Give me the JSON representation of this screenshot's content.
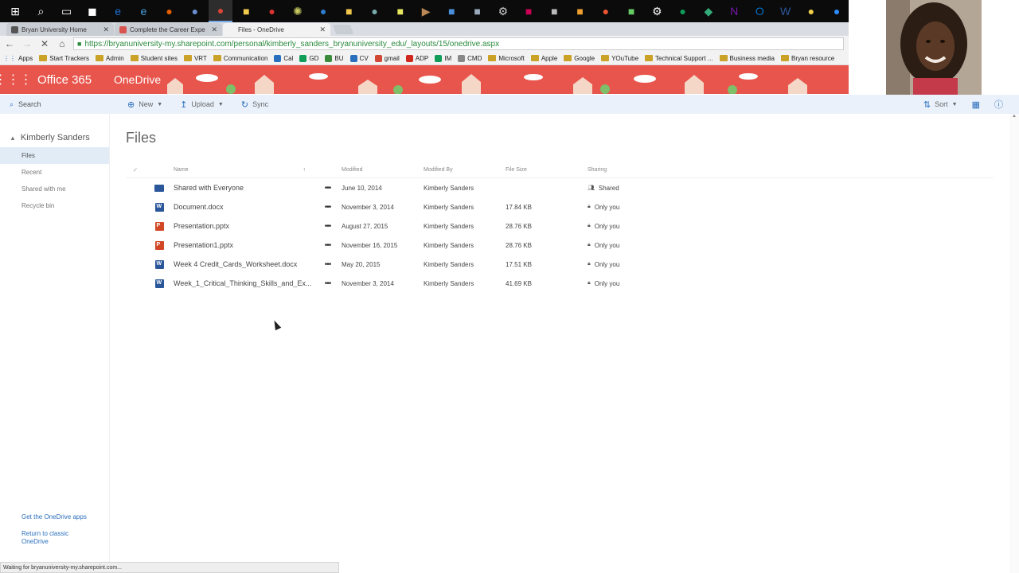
{
  "taskbar": {
    "icons": [
      {
        "name": "windows-start-icon",
        "color": "#ffffff",
        "glyph": "⊞"
      },
      {
        "name": "search-icon",
        "color": "#ffffff",
        "glyph": "⌕"
      },
      {
        "name": "task-view-icon",
        "color": "#ffffff",
        "glyph": "▭"
      },
      {
        "name": "store-icon",
        "color": "#ffffff",
        "glyph": "◼"
      },
      {
        "name": "edge-icon",
        "color": "#1e73d8",
        "glyph": "e"
      },
      {
        "name": "ie-icon",
        "color": "#4aa3df",
        "glyph": "e"
      },
      {
        "name": "firefox-icon",
        "color": "#e66000",
        "glyph": "●"
      },
      {
        "name": "globe-icon",
        "color": "#6a8fd0",
        "glyph": "●"
      },
      {
        "name": "chrome-icon",
        "color": "#db4437",
        "glyph": "●"
      },
      {
        "name": "file-explorer-icon",
        "color": "#f2c94c",
        "glyph": "■"
      },
      {
        "name": "media-icon",
        "color": "#d33",
        "glyph": "●"
      },
      {
        "name": "app-icon",
        "color": "#c8c860",
        "glyph": "✺"
      },
      {
        "name": "app-icon",
        "color": "#2d7dd2",
        "glyph": "●"
      },
      {
        "name": "folder-icon",
        "color": "#f2c94c",
        "glyph": "■"
      },
      {
        "name": "app-icon",
        "color": "#7aa",
        "glyph": "●"
      },
      {
        "name": "app-icon",
        "color": "#e8e860",
        "glyph": "■"
      },
      {
        "name": "app-icon",
        "color": "#b85",
        "glyph": "▶"
      },
      {
        "name": "app-icon",
        "color": "#4a8fd9",
        "glyph": "■"
      },
      {
        "name": "app-icon",
        "color": "#9ab",
        "glyph": "■"
      },
      {
        "name": "app-icon",
        "color": "#ccc",
        "glyph": "⚙"
      },
      {
        "name": "app-icon",
        "color": "#c05",
        "glyph": "■"
      },
      {
        "name": "app-icon",
        "color": "#bbb",
        "glyph": "■"
      },
      {
        "name": "app-icon",
        "color": "#f0a030",
        "glyph": "■"
      },
      {
        "name": "app-icon",
        "color": "#e53",
        "glyph": "●"
      },
      {
        "name": "app-icon",
        "color": "#6c6",
        "glyph": "■"
      },
      {
        "name": "settings-icon",
        "color": "#ffffff",
        "glyph": "⚙"
      },
      {
        "name": "hangouts-icon",
        "color": "#0f9d58",
        "glyph": "●"
      },
      {
        "name": "app-icon",
        "color": "#3a7",
        "glyph": "◆"
      },
      {
        "name": "onenote-icon",
        "color": "#7719aa",
        "glyph": "N"
      },
      {
        "name": "outlook-icon",
        "color": "#0072c6",
        "glyph": "O"
      },
      {
        "name": "word-icon",
        "color": "#2b579a",
        "glyph": "W"
      },
      {
        "name": "app-icon",
        "color": "#f2d04a",
        "glyph": "●"
      },
      {
        "name": "zoom-icon",
        "color": "#2d8cff",
        "glyph": "●"
      }
    ]
  },
  "browser": {
    "tabs": [
      {
        "title": "Bryan University Home",
        "favicon_color": "#555555",
        "active": false
      },
      {
        "title": "Complete the Career Expe",
        "favicon_color": "#d9534f",
        "active": false
      },
      {
        "title": "Files - OneDrive",
        "favicon_color": "#f2f2f2",
        "active": true
      }
    ],
    "close_glyph": "✕",
    "url": "https://bryanuniversity-my.sharepoint.com/personal/kimberly_sanders_bryanuniversity_edu/_layouts/15/onedrive.aspx",
    "bookmarks": [
      {
        "label": "Apps",
        "kind": "apps"
      },
      {
        "label": "Start Trackers",
        "kind": "folder"
      },
      {
        "label": "Admin",
        "kind": "folder"
      },
      {
        "label": "Student sites",
        "kind": "folder"
      },
      {
        "label": "VRT",
        "kind": "folder"
      },
      {
        "label": "Communication",
        "kind": "folder"
      },
      {
        "label": "Cal",
        "kind": "site",
        "color": "#2a6fbd"
      },
      {
        "label": "GD",
        "kind": "site",
        "color": "#0f9d58"
      },
      {
        "label": "BU",
        "kind": "site",
        "color": "#3c8b3c"
      },
      {
        "label": "CV",
        "kind": "site",
        "color": "#2a6fbd"
      },
      {
        "label": "gmail",
        "kind": "site",
        "color": "#d14836"
      },
      {
        "label": "ADP",
        "kind": "site",
        "color": "#d0271d"
      },
      {
        "label": "IM",
        "kind": "site",
        "color": "#0f9d58"
      },
      {
        "label": "CMD",
        "kind": "site",
        "color": "#888888"
      },
      {
        "label": "Microsoft",
        "kind": "folder"
      },
      {
        "label": "Apple",
        "kind": "folder"
      },
      {
        "label": "Google",
        "kind": "folder"
      },
      {
        "label": "YOuTube",
        "kind": "folder"
      },
      {
        "label": "Technical Support ...",
        "kind": "folder"
      },
      {
        "label": "Business media",
        "kind": "folder"
      },
      {
        "label": "Bryan resource",
        "kind": "folder"
      }
    ],
    "status_text": "Waiting for bryanuniversity-my.sharepoint.com..."
  },
  "o365": {
    "brand": "Office 365",
    "app": "OneDrive",
    "accent": "#e8554c"
  },
  "commandbar": {
    "search": "Search",
    "new": "New",
    "upload": "Upload",
    "sync": "Sync",
    "sort": "Sort"
  },
  "leftnav": {
    "user": "Kimberly Sanders",
    "items": [
      {
        "label": "Files",
        "selected": true
      },
      {
        "label": "Recent",
        "selected": false
      },
      {
        "label": "Shared with me",
        "selected": false
      },
      {
        "label": "Recycle bin",
        "selected": false
      }
    ],
    "footer": {
      "get_apps": "Get the OneDrive apps",
      "classic": "Return to classic OneDrive"
    }
  },
  "main": {
    "title": "Files",
    "columns": {
      "check": "✓",
      "name": "Name",
      "sort_glyph": "↑",
      "modified": "Modified",
      "modified_by": "Modified By",
      "size": "File Size",
      "sharing": "Sharing"
    },
    "files": [
      {
        "name": "Shared with Everyone",
        "type": "folder",
        "modified": "June 10, 2014",
        "modified_by": "Kimberly Sanders",
        "size": "",
        "sharing": "Shared",
        "sharing_icon": "people-icon"
      },
      {
        "name": "Document.docx",
        "type": "word",
        "modified": "November 3, 2014",
        "modified_by": "Kimberly Sanders",
        "size": "17.84 KB",
        "sharing": "Only you",
        "sharing_icon": "lock-icon"
      },
      {
        "name": "Presentation.pptx",
        "type": "ppt",
        "modified": "August 27, 2015",
        "modified_by": "Kimberly Sanders",
        "size": "28.76 KB",
        "sharing": "Only you",
        "sharing_icon": "lock-icon"
      },
      {
        "name": "Presentation1.pptx",
        "type": "ppt",
        "modified": "November 16, 2015",
        "modified_by": "Kimberly Sanders",
        "size": "28.76 KB",
        "sharing": "Only you",
        "sharing_icon": "lock-icon"
      },
      {
        "name": "Week 4 Credit_Cards_Worksheet.docx",
        "type": "word",
        "modified": "May 20, 2015",
        "modified_by": "Kimberly Sanders",
        "size": "17.51 KB",
        "sharing": "Only you",
        "sharing_icon": "lock-icon"
      },
      {
        "name": "Week_1_Critical_Thinking_Skills_and_Ex...",
        "type": "word",
        "modified": "November 3, 2014",
        "modified_by": "Kimberly Sanders",
        "size": "41.69 KB",
        "sharing": "Only you",
        "sharing_icon": "lock-icon"
      }
    ],
    "more_glyph": "•••"
  }
}
